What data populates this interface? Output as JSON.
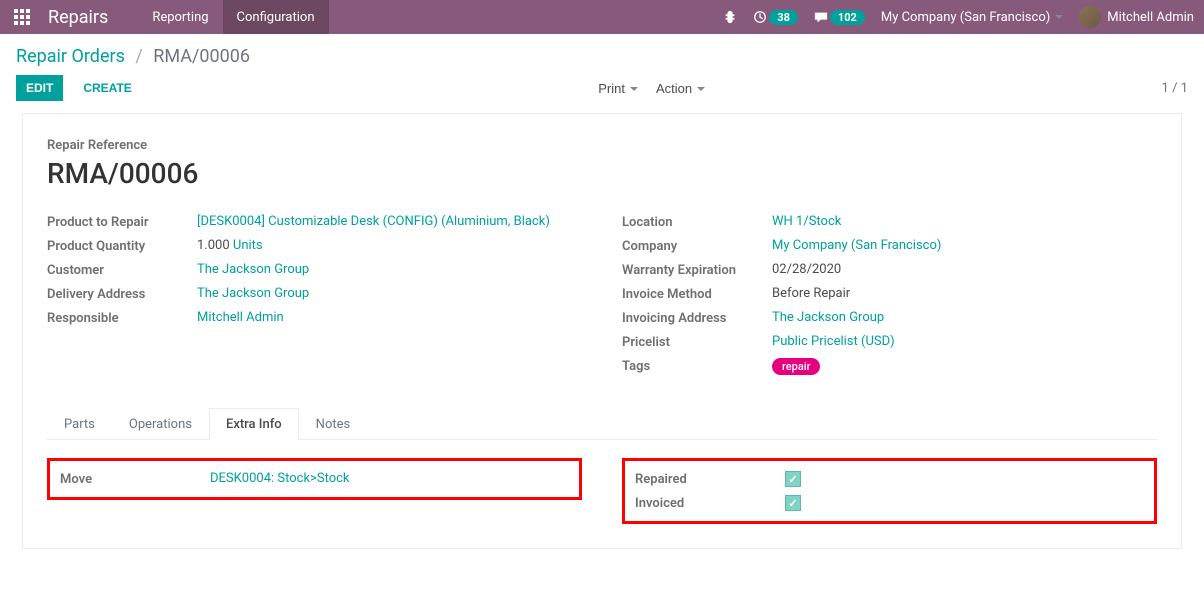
{
  "navbar": {
    "brand": "Repairs",
    "menu": [
      {
        "label": "Reporting",
        "active": false
      },
      {
        "label": "Configuration",
        "active": true
      }
    ],
    "badges": {
      "count1": "38",
      "count2": "102"
    },
    "company": "My Company (San Francisco)",
    "user": "Mitchell Admin"
  },
  "breadcrumb": {
    "parent": "Repair Orders",
    "current": "RMA/00006"
  },
  "toolbar": {
    "edit": "EDIT",
    "create": "CREATE",
    "print": "Print",
    "action": "Action",
    "pager": "1 / 1"
  },
  "header": {
    "label": "Repair Reference",
    "value": "RMA/00006"
  },
  "left_fields": {
    "product_label": "Product to Repair",
    "product_value": "[DESK0004] Customizable Desk (CONFIG) (Aluminium, Black)",
    "qty_label": "Product Quantity",
    "qty_num": "1.000",
    "qty_unit": "Units",
    "customer_label": "Customer",
    "customer_value": "The Jackson Group",
    "delivery_label": "Delivery Address",
    "delivery_value": "The Jackson Group",
    "responsible_label": "Responsible",
    "responsible_value": "Mitchell Admin"
  },
  "right_fields": {
    "location_label": "Location",
    "location_value": "WH 1/Stock",
    "company_label": "Company",
    "company_value": "My Company (San Francisco)",
    "warranty_label": "Warranty Expiration",
    "warranty_value": "02/28/2020",
    "invoice_method_label": "Invoice Method",
    "invoice_method_value": "Before Repair",
    "invoicing_addr_label": "Invoicing Address",
    "invoicing_addr_value": "The Jackson Group",
    "pricelist_label": "Pricelist",
    "pricelist_value": "Public Pricelist (USD)",
    "tags_label": "Tags",
    "tag_value": "repair"
  },
  "tabs": {
    "parts": "Parts",
    "operations": "Operations",
    "extra_info": "Extra Info",
    "notes": "Notes"
  },
  "extra_info": {
    "move_label": "Move",
    "move_value": "DESK0004: Stock>Stock",
    "repaired_label": "Repaired",
    "invoiced_label": "Invoiced"
  }
}
